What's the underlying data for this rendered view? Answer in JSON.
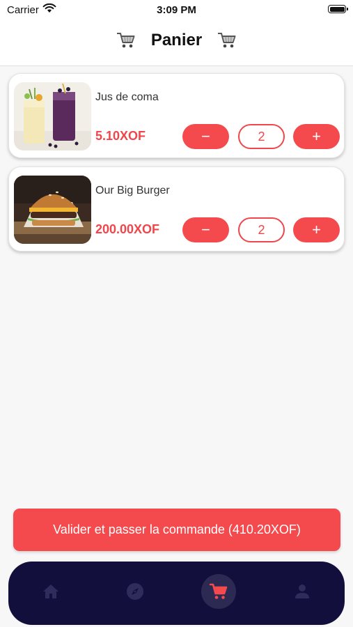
{
  "status_bar": {
    "carrier": "Carrier",
    "time": "3:09 PM"
  },
  "header": {
    "title": "Panier",
    "icon": "shopping-cart-icon"
  },
  "cart": {
    "items": [
      {
        "name": "Jus de coma",
        "price": "5.10XOF",
        "quantity": "2",
        "image": "smoothie-glasses-photo"
      },
      {
        "name": "Our Big Burger",
        "price": "200.00XOF",
        "quantity": "2",
        "image": "burger-photo"
      }
    ],
    "minus_symbol": "−",
    "plus_symbol": "+"
  },
  "checkout": {
    "label": "Valider et passer la commande (410.20XOF)"
  },
  "nav": {
    "items": [
      {
        "icon": "home-icon",
        "active": false
      },
      {
        "icon": "compass-icon",
        "active": false
      },
      {
        "icon": "shopping-cart-icon",
        "active": true
      },
      {
        "icon": "user-icon",
        "active": false
      }
    ]
  },
  "colors": {
    "accent": "#f54a4d",
    "nav_background": "#130f3d",
    "nav_icon_inactive": "#2f2c5c"
  }
}
